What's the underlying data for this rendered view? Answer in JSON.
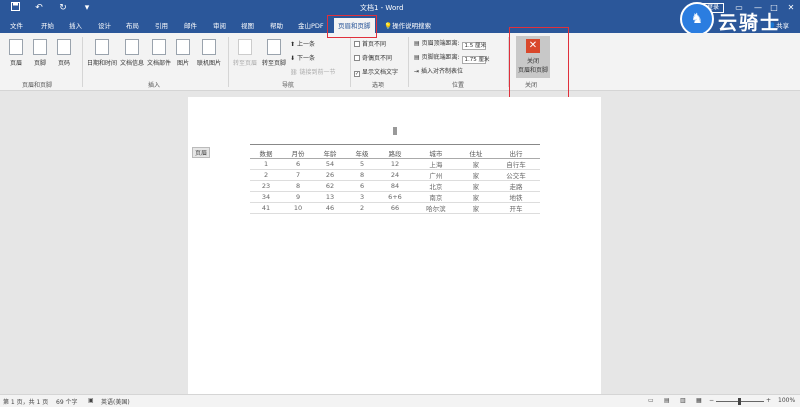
{
  "titlebar": {
    "title": "文档1 - Word",
    "login_label": "登录",
    "qa_save_icon": "save-icon",
    "qa_undo_icon": "undo-icon",
    "qa_redo_icon": "redo-icon",
    "qa_customize_icon": "dropdown-icon",
    "win_ribbon": "▭",
    "win_min": "—",
    "win_max": "□",
    "win_close": "✕"
  },
  "logo": {
    "text": "云骑士",
    "glyph": "♞"
  },
  "tabs": [
    {
      "label": "文件"
    },
    {
      "label": "开始"
    },
    {
      "label": "插入"
    },
    {
      "label": "设计"
    },
    {
      "label": "布局"
    },
    {
      "label": "引用"
    },
    {
      "label": "邮件"
    },
    {
      "label": "审阅"
    },
    {
      "label": "视图"
    },
    {
      "label": "帮助"
    },
    {
      "label": "金山PDF"
    },
    {
      "label": "页眉和页脚"
    }
  ],
  "tell_me": "操作说明搜索",
  "share": "共享",
  "ribbon": {
    "group_hf": {
      "label": "页眉和页脚",
      "items": [
        "页眉",
        "页脚",
        "页码"
      ]
    },
    "group_insert": {
      "label": "插入",
      "items": [
        "日期和时间",
        "文档信息",
        "文档部件",
        "图片",
        "联机图片"
      ]
    },
    "group_nav": {
      "label": "导航",
      "goto_header": "转至页眉",
      "goto_footer": "转至页脚",
      "prev": "上一条",
      "next": "下一条",
      "link_prev": "链接到前一节"
    },
    "group_options": {
      "label": "选项",
      "first_page": "首页不同",
      "odd_even": "奇偶页不同",
      "show_text": "显示文档文字",
      "show_text_check": "✓"
    },
    "group_position": {
      "label": "位置",
      "header_top": "页眉顶端距离:",
      "header_top_val": "1.5 厘米",
      "footer_bottom": "页脚底端距离:",
      "footer_bottom_val": "1.75 厘米",
      "align_tab": "插入对齐制表位"
    },
    "group_close": {
      "label": "关闭",
      "button_line1": "关闭",
      "button_line2": "页眉和页脚",
      "x": "✕"
    }
  },
  "document": {
    "header_tag": "页眉",
    "table": {
      "headers": [
        "数据",
        "月份",
        "年龄",
        "年级",
        "路段",
        "城市",
        "住址",
        "出行"
      ],
      "rows": [
        [
          "1",
          "6",
          "54",
          "5",
          "12",
          "上海",
          "家",
          "自行车"
        ],
        [
          "2",
          "7",
          "26",
          "8",
          "24",
          "广州",
          "家",
          "公交车"
        ],
        [
          "23",
          "8",
          "62",
          "6",
          "84",
          "北京",
          "家",
          "走路"
        ],
        [
          "34",
          "9",
          "13",
          "3",
          "6+6",
          "南京",
          "家",
          "地铁"
        ],
        [
          "41",
          "10",
          "46",
          "2",
          "66",
          "哈尔滨",
          "家",
          "开车"
        ]
      ]
    }
  },
  "statusbar": {
    "page": "第 1 页，共 1 页",
    "words": "69 个字",
    "lang": "英语(美国)",
    "zoom": "100%",
    "zoom_minus": "−",
    "zoom_plus": "+"
  }
}
